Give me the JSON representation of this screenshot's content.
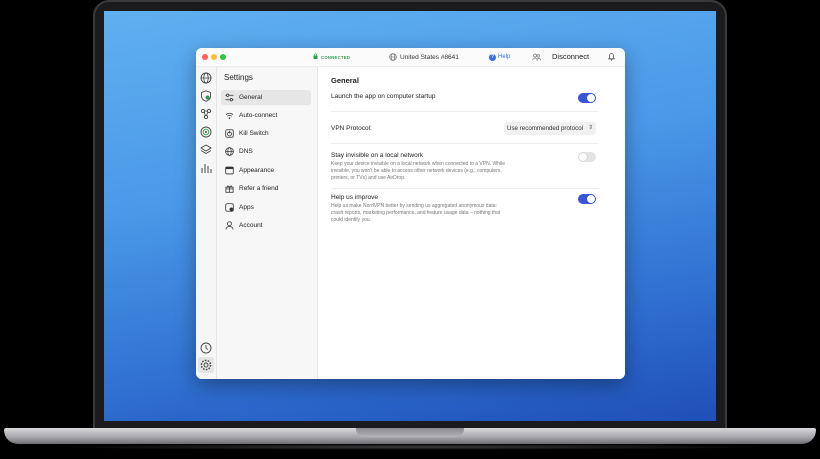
{
  "titlebar": {
    "status": "CONNECTED",
    "server": "United States #8641",
    "help_label": "Help",
    "disconnect_label": "Disconnect"
  },
  "sidebar": {
    "title": "Settings",
    "items": [
      {
        "label": "General",
        "icon": "sliders-icon",
        "active": true
      },
      {
        "label": "Auto-connect",
        "icon": "wifi-icon"
      },
      {
        "label": "Kill Switch",
        "icon": "kill-switch-icon"
      },
      {
        "label": "DNS",
        "icon": "globe-icon"
      },
      {
        "label": "Appearance",
        "icon": "window-icon"
      },
      {
        "label": "Refer a friend",
        "icon": "gift-icon"
      },
      {
        "label": "Apps",
        "icon": "apps-icon"
      },
      {
        "label": "Account",
        "icon": "user-icon"
      }
    ]
  },
  "general": {
    "title": "General",
    "launch_label": "Launch the app on computer startup",
    "launch_on": true,
    "protocol_label": "VPN Protocol:",
    "protocol_value": "Use recommended protocol",
    "invisible_label": "Stay invisible on a local network",
    "invisible_desc": "Keep your device invisible on a local network when connected to a VPN. While invisible, you won't be able to access other network devices (e.g., computers, printers, or TVs) and use AirDrop.",
    "invisible_on": false,
    "improve_label": "Help us improve",
    "improve_desc": "Help us make NordVPN better by sending us aggregated anonymous data: crash reports, marketing performance, and feature usage data – nothing that could identify you.",
    "improve_on": true
  },
  "colors": {
    "accent": "#3a55d6",
    "connected": "#2c9d4f",
    "help": "#3a6ee8"
  }
}
